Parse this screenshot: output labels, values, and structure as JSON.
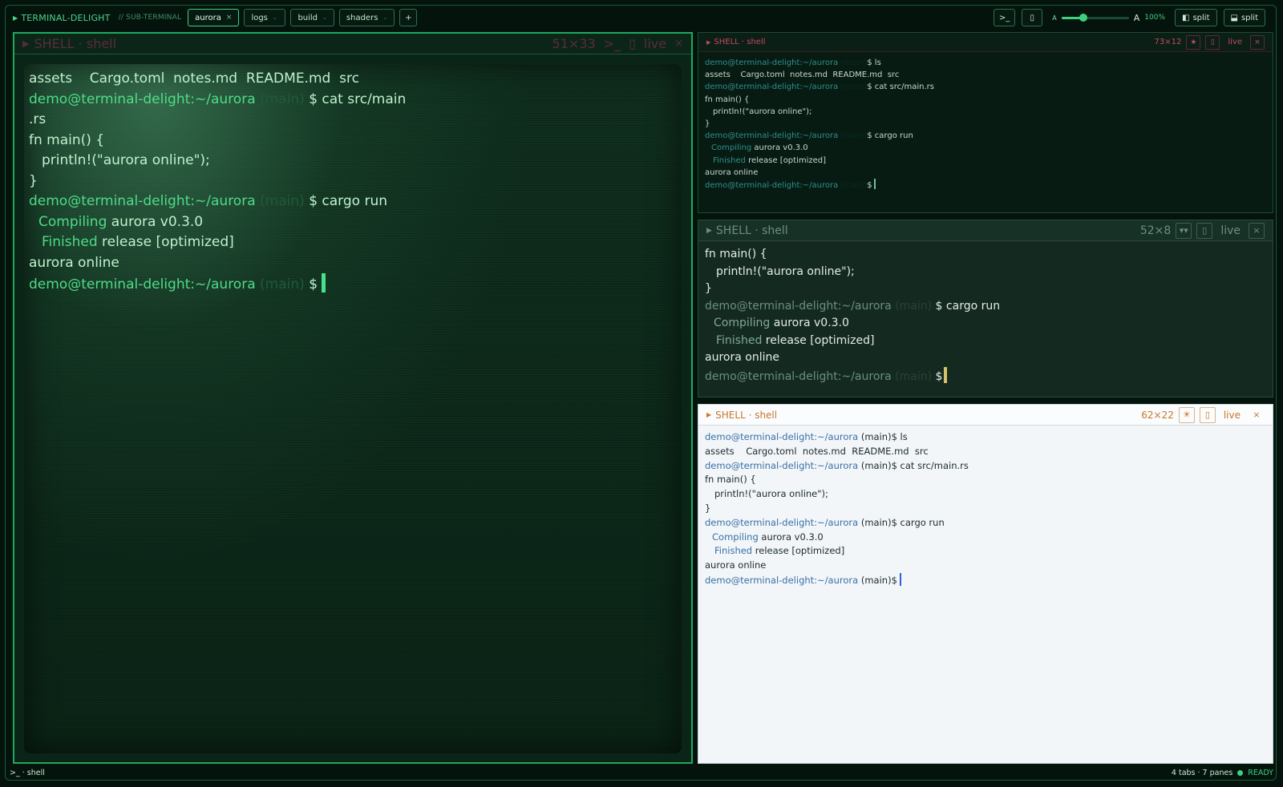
{
  "app": {
    "brand": "TERMINAL-DELIGHT",
    "sub": "// SUB-TERMINAL"
  },
  "tabs": [
    {
      "label": "aurora",
      "close": "×"
    },
    {
      "label": "logs",
      "close": "⌄"
    },
    {
      "label": "build",
      "close": "⌄"
    },
    {
      "label": "shaders",
      "close": "⌄"
    }
  ],
  "add_tab": "+",
  "toolbar": {
    "prompt_btn": ">_",
    "doc_btn": "▯",
    "zoom_small": "A",
    "zoom_large": "A",
    "zoom_pct": "100%",
    "zoom_level": 1.0,
    "split_v": "split",
    "split_h": "split"
  },
  "panes": {
    "left": {
      "title": "SHELL · shell",
      "dims": "51×33",
      "btn_prompt": ">_",
      "btn_doc": "▯",
      "live": "live",
      "close": "×"
    },
    "top_right": {
      "title": "SHELL · shell",
      "dims": "73×12",
      "btn_star": "★",
      "btn_doc": "▯",
      "live": "live",
      "close": "×"
    },
    "mid_right": {
      "title": "SHELL · shell",
      "dims": "52×8",
      "btn_chev": "▾▾",
      "btn_doc": "▯",
      "live": "live",
      "close": "×"
    },
    "bottom_right": {
      "title": "SHELL · shell",
      "dims": "62×22",
      "btn_sun": "☀",
      "btn_doc": "▯",
      "live": "live",
      "close": "×"
    }
  },
  "terminal": {
    "user": "demo@terminal-delight",
    "path": ":~/aurora",
    "branch": "(main)",
    "dollar": "$",
    "cmd_ls": " ls",
    "ls_out": "assets    Cargo.toml  notes.md  README.md  src",
    "cmd_cat": " cat src/main.rs",
    "cmd_cat_a": " cat src/main",
    "cmd_cat_b": ".rs",
    "fn_open": "fn main() {",
    "println": "println!(\"aurora online\");",
    "fn_close": "}",
    "cmd_run": " cargo run",
    "compiling": "Compiling",
    "compiling_rest": " aurora v0.3.0",
    "finished": "Finished",
    "finished_rest": " release [optimized]",
    "output": "aurora online"
  },
  "status": {
    "left": ">_ · shell",
    "counts": "4 tabs · 7 panes",
    "state": "READY"
  },
  "colors": {
    "accent": "#3fd07f",
    "crt_bg": "#0b2517",
    "light_bg": "#f2f6f8",
    "danger": "#c24a5f",
    "warn": "#c8772b"
  }
}
